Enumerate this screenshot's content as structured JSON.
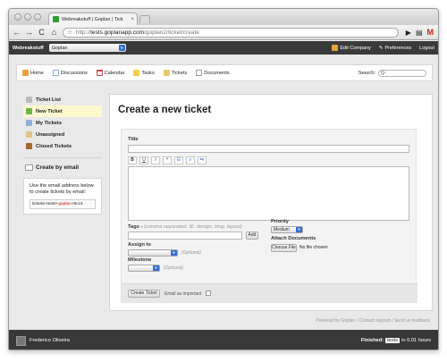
{
  "browser": {
    "tab_title": "Webreakstuff | Goplan | Tick",
    "url_prefix": "http://",
    "url_host": "tests.goplanapp.com",
    "url_path": "/goplan2/ticket/create"
  },
  "topbar": {
    "brand": "Webreakstuff",
    "project": "Goplan",
    "edit_company": "Edit Company",
    "preferences": "Preferences",
    "logout": "Logout"
  },
  "mainnav": {
    "items": [
      "Home",
      "Discussions",
      "Calendar",
      "Tasks",
      "Tickets",
      "Documents"
    ],
    "search_label": "Search:",
    "search_value": "Q‑"
  },
  "sidebar": {
    "items": [
      "Ticket List",
      "New Ticket",
      "My Tickets",
      "Unassigned",
      "Closed Tickets"
    ],
    "create_by_email": "Create by email",
    "info": "Use the email address below to create tickets by email:",
    "email_prefix": "tickets+tests+",
    "email_highlight": "goplan",
    "email_suffix": "+6cc4"
  },
  "form": {
    "heading": "Create a new ticket",
    "title_label": "Title",
    "toolbar_buttons": [
      "B",
      "U",
      "I",
      "❝",
      "☰",
      "≡",
      "⇆"
    ],
    "tags_label": "Tags",
    "tags_hint": "(comma separated. IE: design, blog, layout)",
    "add_button": "Add",
    "assign_label": "Assign to",
    "optional": "(Optional)",
    "milestone_label": "Milestone",
    "priority_label": "Priority",
    "priority_value": "Medium",
    "attach_label": "Attach Documents",
    "choose_file": "Choose File",
    "no_file": "No file chosen",
    "create_button": "Create Ticket",
    "email_important": "Email as important"
  },
  "footer": {
    "powered": "Powered by Goplan / Contact support / Send us feedback"
  },
  "status": {
    "user": "Frederico Oliveira",
    "finished_label": "Finished:",
    "finished_tag": "tests",
    "finished_time": "in 0.01 hours"
  },
  "colors": {
    "topbar": "#3a3a3a",
    "active_item": "#fdf7cf",
    "select_arrow": "#3a6fd0"
  }
}
